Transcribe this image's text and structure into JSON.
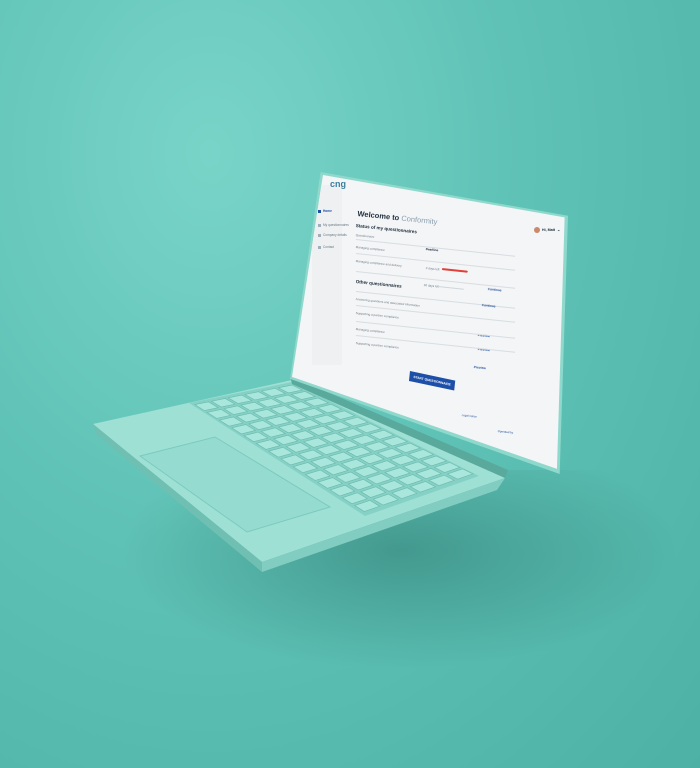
{
  "brand": {
    "logo": "cng",
    "logo_sub": ""
  },
  "sidebar": {
    "items": [
      {
        "label": "Home",
        "active": true
      },
      {
        "label": "My questionnaires",
        "active": false
      },
      {
        "label": "Company details",
        "active": false
      },
      {
        "label": "Contact",
        "active": false
      }
    ]
  },
  "user": {
    "greeting": "Hi, Matt"
  },
  "page": {
    "title_prefix": "Welcome to",
    "title_brand": "Conformity",
    "status_heading": "Status of my questionnaires",
    "col_questionnaire": "Questionnaire",
    "col_deadline": "Deadline",
    "other_heading": "Other questionnaires",
    "start_button": "START QUESTIONNAIRE"
  },
  "status_rows": [
    {
      "name": "Managing compliance",
      "deadline": "",
      "action": ""
    },
    {
      "name": "Managing compliance and delivery",
      "deadline": "3 days left",
      "action": ""
    },
    {
      "name": "",
      "deadline": "30 days left",
      "action": "Continue"
    }
  ],
  "other_rows": [
    {
      "name": "Answering questions and associated information",
      "action": "Continue"
    },
    {
      "name": "Supporting a partner compliance",
      "action": "Preview"
    },
    {
      "name": "Managing compliance",
      "action": "Preview"
    },
    {
      "name": "Supporting a partner compliance",
      "action": "Preview"
    }
  ],
  "footer": {
    "note": "",
    "link_a": "Legal notice",
    "link_b": "Operated by"
  },
  "colors": {
    "background": "#5fc2b6",
    "laptop_body": "#8fd8cc",
    "primary_button": "#1d4fa8",
    "deadline_bar": "#e0403a"
  }
}
